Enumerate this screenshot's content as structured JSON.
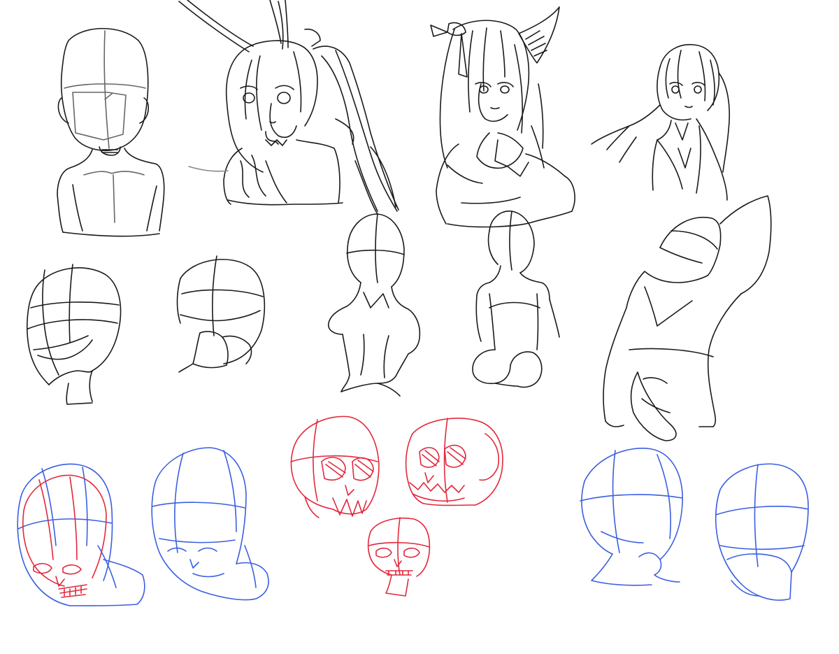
{
  "colors": {
    "background": "#ffffff",
    "pencil": "#1a1a1a",
    "guide": "#555555",
    "red_ink": "#e2283c",
    "blue_ink": "#3a5fe0",
    "eye_blue": "#2d4b8a"
  },
  "sketches": [
    {
      "name": "bald-head-bust-sketch",
      "color": "pencil"
    },
    {
      "name": "bunny-ear-girl-sketch",
      "color": "pencil"
    },
    {
      "name": "horned-ribbon-girl-sketch",
      "color": "pencil"
    },
    {
      "name": "suit-girl-sketch",
      "color": "pencil"
    },
    {
      "name": "head-construction-sketch",
      "color": "pencil"
    },
    {
      "name": "back-head-sketch",
      "color": "pencil"
    },
    {
      "name": "back-bust-sketch",
      "color": "pencil"
    },
    {
      "name": "back-torso-sketch",
      "color": "pencil"
    },
    {
      "name": "reclining-torso-sketch",
      "color": "pencil"
    },
    {
      "name": "skull-overlay-head-sketch",
      "color": "red_ink"
    },
    {
      "name": "blue-head-lowered-sketch",
      "color": "blue_ink"
    },
    {
      "name": "skull-left-sketch",
      "color": "red_ink"
    },
    {
      "name": "skull-right-sketch",
      "color": "red_ink"
    },
    {
      "name": "skull-bottom-sketch",
      "color": "red_ink"
    },
    {
      "name": "blue-head-turned-sketch",
      "color": "blue_ink"
    },
    {
      "name": "blue-head-front-sketch",
      "color": "blue_ink"
    }
  ]
}
